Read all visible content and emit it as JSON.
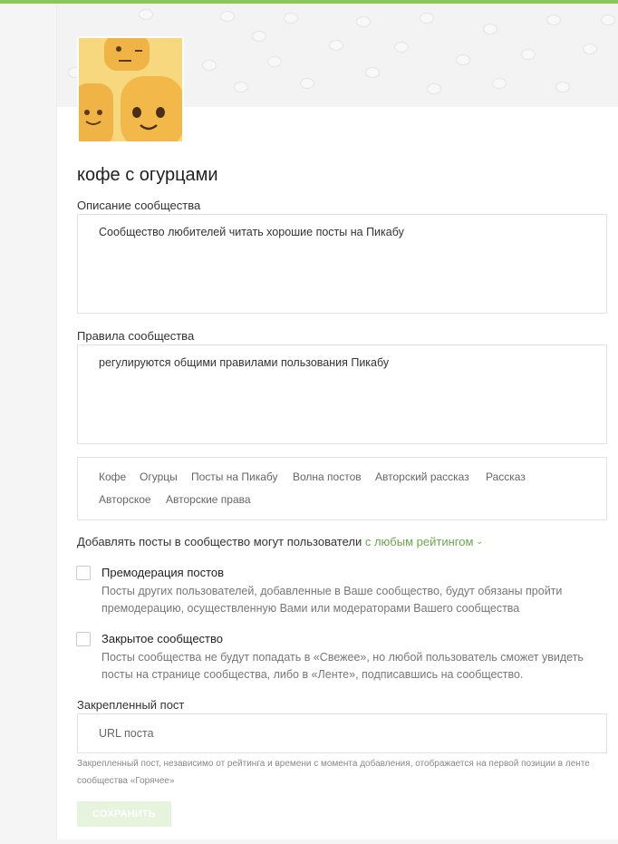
{
  "community": {
    "title": "кофе с огурцами"
  },
  "description": {
    "label": "Описание сообщества",
    "value": "Сообщество любителей  читать хорошие посты на Пикабу"
  },
  "rules": {
    "label": "Правила сообщества",
    "value": "регулируются общими правилами пользования Пикабу"
  },
  "tags": [
    "Кофе",
    "Огурцы",
    "Посты на Пикабу",
    "Волна постов",
    "Авторский рассказ",
    "Рассказ",
    "Авторское",
    "Авторские права"
  ],
  "posting": {
    "text": "Добавлять посты в сообщество могут пользователи",
    "rating_value": "с любым рейтингом"
  },
  "premoderation": {
    "title": "Премодерация постов",
    "description": "Посты других пользователей, добавленные в Ваше сообщество, будут обязаны пройти премодерацию, осуществленную Вами или модераторами Вашего сообщества",
    "checked": false
  },
  "closed": {
    "title": "Закрытое сообщество",
    "description": "Посты сообщества не будут попадать в «Свежее», но любой пользователь сможет увидеть посты на странице сообщества, либо в «Ленте», подписавшись на сообщество.",
    "checked": false
  },
  "pinned": {
    "label": "Закрепленный пост",
    "placeholder": "URL поста",
    "hint": "Закрепленный пост, независимо от рейтинга и времени с момента добавления, отображается на первой позиции в ленте сообщества «Горячее»"
  },
  "save_label": "СОХРАНИТЬ",
  "colors": {
    "accent": "#8ac858",
    "link": "#6aa84f",
    "button_disabled": "#e6f3dd"
  },
  "icons": {
    "avatar": "cartoon-faces-avatar",
    "dropdown": "chevron-down-icon"
  }
}
